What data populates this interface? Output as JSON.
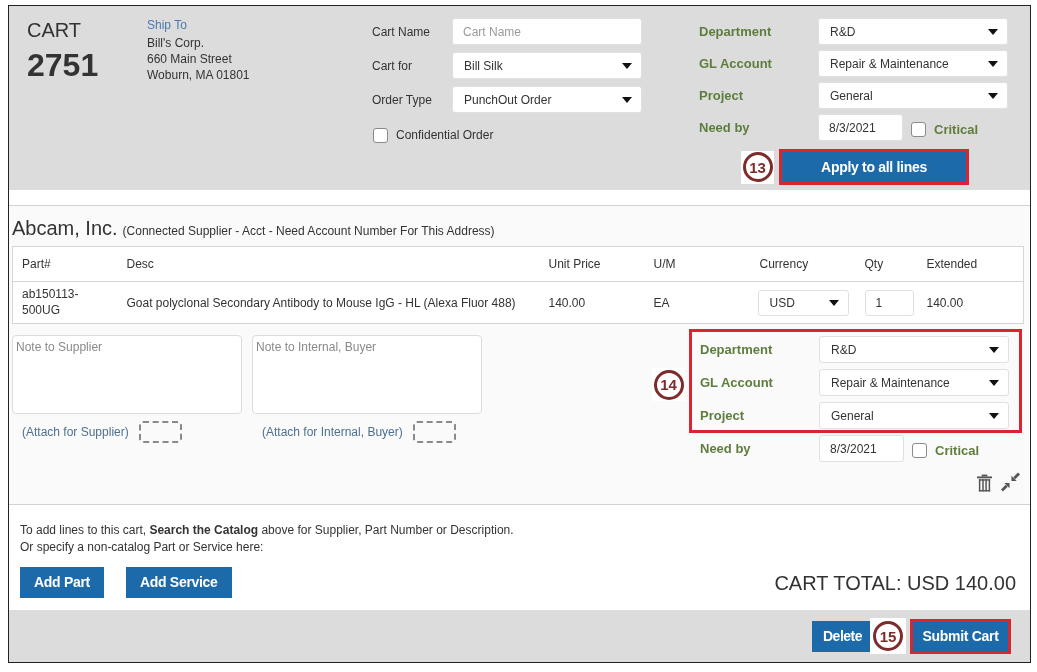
{
  "cart": {
    "title": "CART",
    "number": "2751"
  },
  "ship_to": {
    "link": "Ship To",
    "address": [
      "Bill's Corp.",
      "660 Main Street",
      "Woburn, MA 01801"
    ]
  },
  "cart_fields": [
    {
      "kind": "input",
      "label": "Cart Name",
      "placeholder": "Cart Name"
    },
    {
      "kind": "select",
      "label": "Cart for",
      "value": "Bill Silk"
    },
    {
      "kind": "select",
      "label": "Order Type",
      "value": "PunchOut Order"
    },
    {
      "kind": "checkbox",
      "label": "Confidential Order",
      "checked": false
    }
  ],
  "header_coding": {
    "fields": [
      {
        "kind": "select",
        "label": "Department",
        "value": "R&D"
      },
      {
        "kind": "select",
        "label": "GL Account",
        "value": "Repair & Maintenance"
      },
      {
        "kind": "select",
        "label": "Project",
        "value": "General"
      },
      {
        "kind": "date",
        "label": "Need by",
        "value": "8/3/2021",
        "flag": {
          "label": "Critical",
          "checked": false
        }
      }
    ],
    "apply": {
      "label": "Apply to all lines",
      "step": "13",
      "highlighted": true
    }
  },
  "supplier": {
    "name": "Abcam, Inc.",
    "note": "(Connected Supplier - Acct - Need Account Number For This Address)"
  },
  "table": {
    "columns": [
      "Part#",
      "Desc",
      "Unit Price",
      "U/M",
      "Currency",
      "Qty",
      "Extended"
    ],
    "rows": [
      {
        "part": "ab150113-500UG",
        "desc": "Goat polyclonal Secondary Antibody to Mouse IgG - HL (Alexa Fluor 488)",
        "unit_price": "140.00",
        "um": "EA",
        "currency": "USD",
        "qty": "1",
        "extended": "140.00"
      }
    ]
  },
  "line": {
    "notes": [
      {
        "placeholder": "Note to Supplier",
        "attach": "(Attach for Supplier)"
      },
      {
        "placeholder": "Note to Internal, Buyer",
        "attach": "(Attach for Internal, Buyer)"
      }
    ],
    "coding": {
      "step": "14",
      "highlighted": true,
      "fields": [
        {
          "label": "Department",
          "value": "R&D"
        },
        {
          "label": "GL Account",
          "value": "Repair & Maintenance"
        },
        {
          "label": "Project",
          "value": "General"
        }
      ]
    },
    "need_by": {
      "label": "Need by",
      "value": "8/3/2021",
      "critical": {
        "label": "Critical",
        "checked": false
      }
    }
  },
  "add_lines": {
    "text": [
      "To add lines to this cart, **Search the Catalog** above for Supplier, Part Number or Description.",
      "Or specify a non-catalog Part or Service here:"
    ],
    "buttons": [
      "Add Part",
      "Add Service"
    ]
  },
  "cart_total": "CART TOTAL: USD 140.00",
  "footer": {
    "delete": {
      "label": "Delete"
    },
    "step": "15",
    "submit": {
      "label": "Submit Cart",
      "highlighted": true
    }
  }
}
